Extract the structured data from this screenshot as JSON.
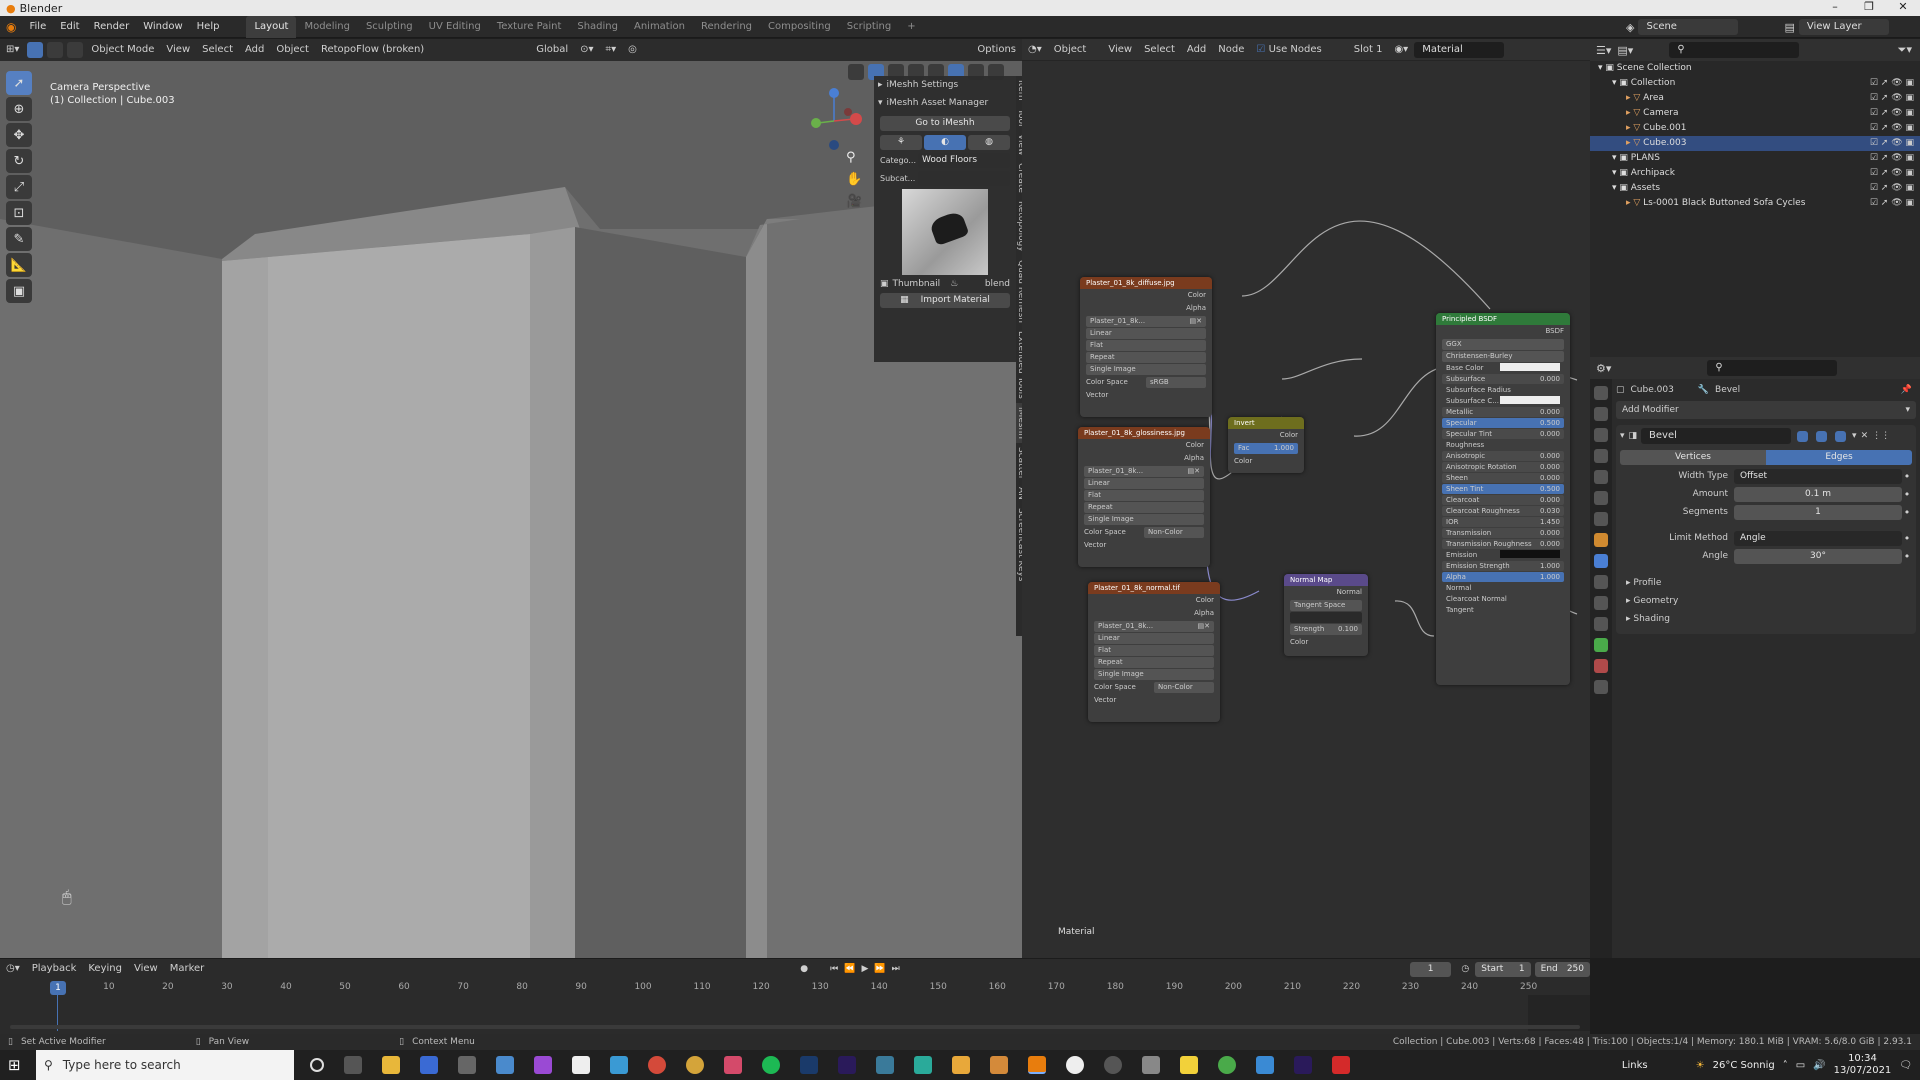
{
  "window": {
    "title": "Blender",
    "controls": [
      "–",
      "❐",
      "✕"
    ]
  },
  "menu": {
    "items": [
      "File",
      "Edit",
      "Render",
      "Window",
      "Help"
    ]
  },
  "workspaces": {
    "tabs": [
      "Layout",
      "Modeling",
      "Sculpting",
      "UV Editing",
      "Texture Paint",
      "Shading",
      "Animation",
      "Rendering",
      "Compositing",
      "Scripting"
    ],
    "active": "Layout",
    "add": "+"
  },
  "scene": {
    "label": "Scene",
    "view_layer": "View Layer"
  },
  "viewport": {
    "header": {
      "mode": "Object Mode",
      "view": "View",
      "select": "Select",
      "add": "Add",
      "object": "Object",
      "addon": "RetopoFlow (broken)",
      "orientation": "Global",
      "options": "Options"
    },
    "overlay_title": "Camera Perspective",
    "overlay_sub": "(1) Collection | Cube.003"
  },
  "npanel": {
    "settings": "iMeshh Settings",
    "manager": "iMeshh Asset Manager",
    "goto": "Go to iMeshh",
    "category_label": "Catego...",
    "category_value": "Wood Floors",
    "subcategory_label": "Subcat...",
    "thumbnail": "Thumbnail",
    "blend": "blend",
    "import": "Import Material",
    "tabs": [
      "Item",
      "Tool",
      "View",
      "Create",
      "Retopology",
      "Quad Remesh",
      "Extended Tools",
      "iMeshh",
      "Scatter",
      "AN",
      "Screencast Keys"
    ]
  },
  "node_editor": {
    "header": {
      "object": "Object",
      "view": "View",
      "select": "Select",
      "add": "Add",
      "node": "Node",
      "use_nodes": "Use Nodes",
      "slot": "Slot 1",
      "material": "Material"
    },
    "footer_label": "Material",
    "nodes": {
      "diffuse": {
        "title": "Plaster_01_8k_diffuse.jpg",
        "out1": "Color",
        "out2": "Alpha",
        "image": "Plaster_01_8k...",
        "opts": [
          "Linear",
          "Flat",
          "Repeat",
          "Single Image"
        ],
        "cs_label": "Color Space",
        "cs_value": "sRGB",
        "vector": "Vector"
      },
      "gloss": {
        "title": "Plaster_01_8k_glossiness.jpg",
        "out1": "Color",
        "out2": "Alpha",
        "image": "Plaster_01_8k...",
        "opts": [
          "Linear",
          "Flat",
          "Repeat",
          "Single Image"
        ],
        "cs_label": "Color Space",
        "cs_value": "Non-Color",
        "vector": "Vector"
      },
      "normal": {
        "title": "Plaster_01_8k_normal.tif",
        "out1": "Color",
        "out2": "Alpha",
        "image": "Plaster_01_8k...",
        "opts": [
          "Linear",
          "Flat",
          "Repeat",
          "Single Image"
        ],
        "cs_label": "Color Space",
        "cs_value": "Non-Color",
        "vector": "Vector"
      },
      "invert": {
        "title": "Invert",
        "out": "Color",
        "fac_label": "Fac",
        "fac_value": "1.000",
        "in": "Color"
      },
      "normalmap": {
        "title": "Normal Map",
        "out": "Normal",
        "space": "Tangent Space",
        "strength_label": "Strength",
        "strength_value": "0.100",
        "in": "Color"
      },
      "bsdf": {
        "title": "Principled BSDF",
        "out": "BSDF",
        "dist": "GGX",
        "sss": "Christensen-Burley",
        "rows": [
          {
            "label": "Base Color",
            "value": ""
          },
          {
            "label": "Subsurface",
            "value": "0.000"
          },
          {
            "label": "Subsurface Radius",
            "value": ""
          },
          {
            "label": "Subsurface C...",
            "value": ""
          },
          {
            "label": "Metallic",
            "value": "0.000"
          },
          {
            "label": "Specular",
            "value": "0.500"
          },
          {
            "label": "Specular Tint",
            "value": "0.000"
          },
          {
            "label": "Roughness",
            "value": ""
          },
          {
            "label": "Anisotropic",
            "value": "0.000"
          },
          {
            "label": "Anisotropic Rotation",
            "value": "0.000"
          },
          {
            "label": "Sheen",
            "value": "0.000"
          },
          {
            "label": "Sheen Tint",
            "value": "0.500"
          },
          {
            "label": "Clearcoat",
            "value": "0.000"
          },
          {
            "label": "Clearcoat Roughness",
            "value": "0.030"
          },
          {
            "label": "IOR",
            "value": "1.450"
          },
          {
            "label": "Transmission",
            "value": "0.000"
          },
          {
            "label": "Transmission Roughness",
            "value": "0.000"
          },
          {
            "label": "Emission",
            "value": ""
          },
          {
            "label": "Emission Strength",
            "value": "1.000"
          },
          {
            "label": "Alpha",
            "value": "1.000"
          },
          {
            "label": "Normal",
            "value": ""
          },
          {
            "label": "Clearcoat Normal",
            "value": ""
          },
          {
            "label": "Tangent",
            "value": ""
          }
        ]
      }
    }
  },
  "outliner": {
    "rows": [
      {
        "label": "Scene Collection",
        "indent": 0
      },
      {
        "label": "Collection",
        "indent": 1
      },
      {
        "label": "Area",
        "indent": 2
      },
      {
        "label": "Camera",
        "indent": 2
      },
      {
        "label": "Cube.001",
        "indent": 2
      },
      {
        "label": "Cube.003",
        "indent": 2
      },
      {
        "label": "PLANS",
        "indent": 1
      },
      {
        "label": "Archipack",
        "indent": 1
      },
      {
        "label": "Assets",
        "indent": 1
      },
      {
        "label": "Ls-0001 Black Buttoned Sofa Cycles",
        "indent": 2
      }
    ]
  },
  "properties": {
    "object": "Cube.003",
    "modifier_name": "Bevel",
    "add_modifier": "Add Modifier",
    "tab_vertices": "Vertices",
    "tab_edges": "Edges",
    "width_type_label": "Width Type",
    "width_type_value": "Offset",
    "amount_label": "Amount",
    "amount_value": "0.1 m",
    "segments_label": "Segments",
    "segments_value": "1",
    "limit_label": "Limit Method",
    "limit_value": "Angle",
    "angle_label": "Angle",
    "angle_value": "30°",
    "sections": [
      "Profile",
      "Geometry",
      "Shading"
    ]
  },
  "timeline": {
    "menus": [
      "Playback",
      "Keying",
      "View",
      "Marker"
    ],
    "current_frame": "1",
    "start_label": "Start",
    "start_value": "1",
    "end_label": "End",
    "end_value": "250",
    "ticks": [
      "1",
      "10",
      "20",
      "30",
      "40",
      "50",
      "60",
      "70",
      "80",
      "90",
      "100",
      "110",
      "120",
      "130",
      "140",
      "150",
      "160",
      "170",
      "180",
      "190",
      "200",
      "210",
      "220",
      "230",
      "240",
      "250"
    ]
  },
  "status": {
    "left1": "Set Active Modifier",
    "left2": "Pan View",
    "left3": "Context Menu",
    "right": "Collection | Cube.003 | Verts:68 | Faces:48 | Tris:100 | Objects:1/4 | Memory: 180.1 MiB | VRAM: 5.6/8.0 GiB | 2.93.1"
  },
  "taskbar": {
    "search_placeholder": "Type here to search",
    "links": "Links",
    "weather": "26°C Sonnig",
    "time": "10:34",
    "date": "13/07/2021"
  }
}
